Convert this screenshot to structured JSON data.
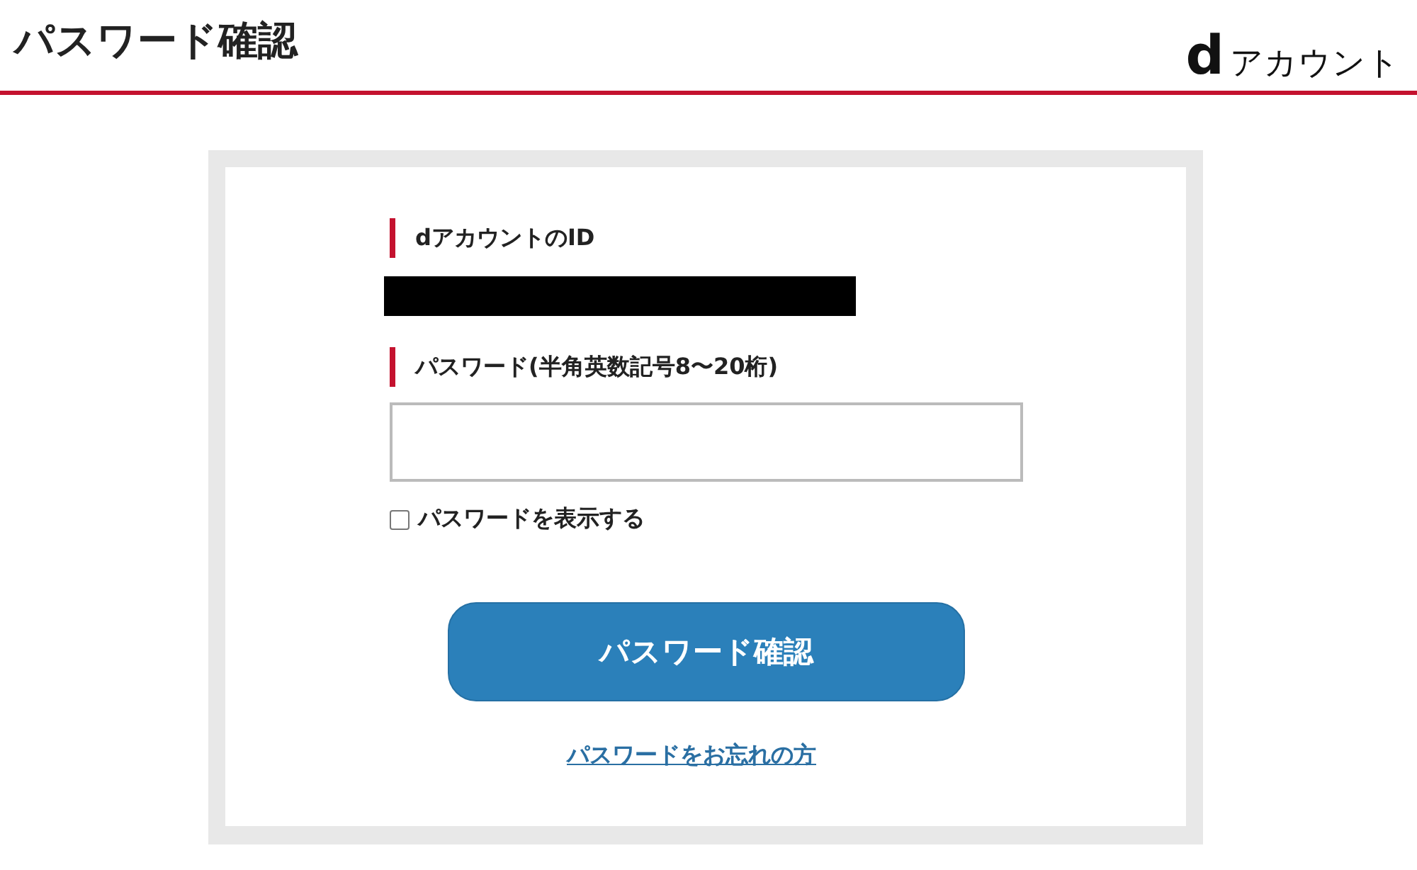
{
  "header": {
    "title": "パスワード確認",
    "logo_mark": "d",
    "logo_text": "アカウント"
  },
  "form": {
    "id_label": "dアカウントのID",
    "id_redacted": true,
    "password_label": "パスワード(半角英数記号8〜20桁)",
    "show_password": {
      "label": "パスワードを表示する",
      "checked": false
    },
    "submit": "パスワード確認",
    "forgot_link": "パスワードをお忘れの方"
  }
}
